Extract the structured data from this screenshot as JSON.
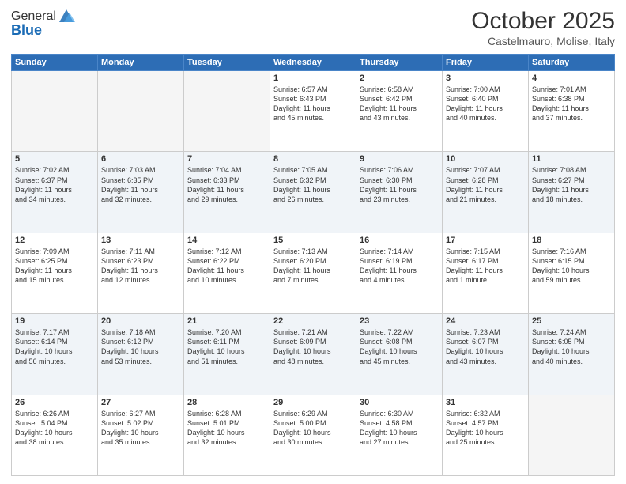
{
  "header": {
    "logo_line1": "General",
    "logo_line2": "Blue",
    "month": "October 2025",
    "location": "Castelmauro, Molise, Italy"
  },
  "weekdays": [
    "Sunday",
    "Monday",
    "Tuesday",
    "Wednesday",
    "Thursday",
    "Friday",
    "Saturday"
  ],
  "weeks": [
    [
      {
        "day": "",
        "info": ""
      },
      {
        "day": "",
        "info": ""
      },
      {
        "day": "",
        "info": ""
      },
      {
        "day": "1",
        "info": "Sunrise: 6:57 AM\nSunset: 6:43 PM\nDaylight: 11 hours\nand 45 minutes."
      },
      {
        "day": "2",
        "info": "Sunrise: 6:58 AM\nSunset: 6:42 PM\nDaylight: 11 hours\nand 43 minutes."
      },
      {
        "day": "3",
        "info": "Sunrise: 7:00 AM\nSunset: 6:40 PM\nDaylight: 11 hours\nand 40 minutes."
      },
      {
        "day": "4",
        "info": "Sunrise: 7:01 AM\nSunset: 6:38 PM\nDaylight: 11 hours\nand 37 minutes."
      }
    ],
    [
      {
        "day": "5",
        "info": "Sunrise: 7:02 AM\nSunset: 6:37 PM\nDaylight: 11 hours\nand 34 minutes."
      },
      {
        "day": "6",
        "info": "Sunrise: 7:03 AM\nSunset: 6:35 PM\nDaylight: 11 hours\nand 32 minutes."
      },
      {
        "day": "7",
        "info": "Sunrise: 7:04 AM\nSunset: 6:33 PM\nDaylight: 11 hours\nand 29 minutes."
      },
      {
        "day": "8",
        "info": "Sunrise: 7:05 AM\nSunset: 6:32 PM\nDaylight: 11 hours\nand 26 minutes."
      },
      {
        "day": "9",
        "info": "Sunrise: 7:06 AM\nSunset: 6:30 PM\nDaylight: 11 hours\nand 23 minutes."
      },
      {
        "day": "10",
        "info": "Sunrise: 7:07 AM\nSunset: 6:28 PM\nDaylight: 11 hours\nand 21 minutes."
      },
      {
        "day": "11",
        "info": "Sunrise: 7:08 AM\nSunset: 6:27 PM\nDaylight: 11 hours\nand 18 minutes."
      }
    ],
    [
      {
        "day": "12",
        "info": "Sunrise: 7:09 AM\nSunset: 6:25 PM\nDaylight: 11 hours\nand 15 minutes."
      },
      {
        "day": "13",
        "info": "Sunrise: 7:11 AM\nSunset: 6:23 PM\nDaylight: 11 hours\nand 12 minutes."
      },
      {
        "day": "14",
        "info": "Sunrise: 7:12 AM\nSunset: 6:22 PM\nDaylight: 11 hours\nand 10 minutes."
      },
      {
        "day": "15",
        "info": "Sunrise: 7:13 AM\nSunset: 6:20 PM\nDaylight: 11 hours\nand 7 minutes."
      },
      {
        "day": "16",
        "info": "Sunrise: 7:14 AM\nSunset: 6:19 PM\nDaylight: 11 hours\nand 4 minutes."
      },
      {
        "day": "17",
        "info": "Sunrise: 7:15 AM\nSunset: 6:17 PM\nDaylight: 11 hours\nand 1 minute."
      },
      {
        "day": "18",
        "info": "Sunrise: 7:16 AM\nSunset: 6:15 PM\nDaylight: 10 hours\nand 59 minutes."
      }
    ],
    [
      {
        "day": "19",
        "info": "Sunrise: 7:17 AM\nSunset: 6:14 PM\nDaylight: 10 hours\nand 56 minutes."
      },
      {
        "day": "20",
        "info": "Sunrise: 7:18 AM\nSunset: 6:12 PM\nDaylight: 10 hours\nand 53 minutes."
      },
      {
        "day": "21",
        "info": "Sunrise: 7:20 AM\nSunset: 6:11 PM\nDaylight: 10 hours\nand 51 minutes."
      },
      {
        "day": "22",
        "info": "Sunrise: 7:21 AM\nSunset: 6:09 PM\nDaylight: 10 hours\nand 48 minutes."
      },
      {
        "day": "23",
        "info": "Sunrise: 7:22 AM\nSunset: 6:08 PM\nDaylight: 10 hours\nand 45 minutes."
      },
      {
        "day": "24",
        "info": "Sunrise: 7:23 AM\nSunset: 6:07 PM\nDaylight: 10 hours\nand 43 minutes."
      },
      {
        "day": "25",
        "info": "Sunrise: 7:24 AM\nSunset: 6:05 PM\nDaylight: 10 hours\nand 40 minutes."
      }
    ],
    [
      {
        "day": "26",
        "info": "Sunrise: 6:26 AM\nSunset: 5:04 PM\nDaylight: 10 hours\nand 38 minutes."
      },
      {
        "day": "27",
        "info": "Sunrise: 6:27 AM\nSunset: 5:02 PM\nDaylight: 10 hours\nand 35 minutes."
      },
      {
        "day": "28",
        "info": "Sunrise: 6:28 AM\nSunset: 5:01 PM\nDaylight: 10 hours\nand 32 minutes."
      },
      {
        "day": "29",
        "info": "Sunrise: 6:29 AM\nSunset: 5:00 PM\nDaylight: 10 hours\nand 30 minutes."
      },
      {
        "day": "30",
        "info": "Sunrise: 6:30 AM\nSunset: 4:58 PM\nDaylight: 10 hours\nand 27 minutes."
      },
      {
        "day": "31",
        "info": "Sunrise: 6:32 AM\nSunset: 4:57 PM\nDaylight: 10 hours\nand 25 minutes."
      },
      {
        "day": "",
        "info": ""
      }
    ]
  ]
}
